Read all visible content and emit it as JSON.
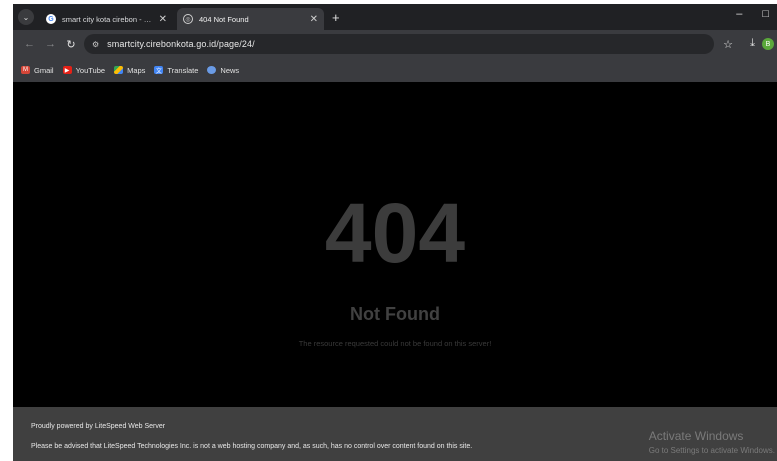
{
  "browser": {
    "tabs": [
      {
        "title": "smart city kota cirebon - Peneli...",
        "active": false,
        "favicon": "google-icon"
      },
      {
        "title": "404 Not Found",
        "active": true,
        "favicon": "globe-icon"
      }
    ],
    "new_tab_symbol": "+",
    "address_bar": {
      "url": "smartcity.cirebonkota.go.id/page/24/"
    },
    "profile_initial": "B",
    "bookmarks": [
      {
        "label": "Gmail",
        "icon": "gmail-icon"
      },
      {
        "label": "YouTube",
        "icon": "youtube-icon"
      },
      {
        "label": "Maps",
        "icon": "maps-icon"
      },
      {
        "label": "Translate",
        "icon": "translate-icon"
      },
      {
        "label": "News",
        "icon": "news-icon"
      }
    ]
  },
  "page": {
    "code": "404",
    "title": "Not Found",
    "message": "The resource requested could not be found on this server!",
    "footer": {
      "powered_by": "Proudly powered by LiteSpeed Web Server",
      "disclaimer": "Please be advised that LiteSpeed Technologies Inc. is not a web hosting company and, as such, has no control over content found on this site."
    }
  },
  "watermark": {
    "line1": "Activate Windows",
    "line2": "Go to Settings to activate Windows."
  },
  "colors": {
    "background": "#000000",
    "code_text": "#3c3c3c",
    "footer_bg": "#404040"
  }
}
